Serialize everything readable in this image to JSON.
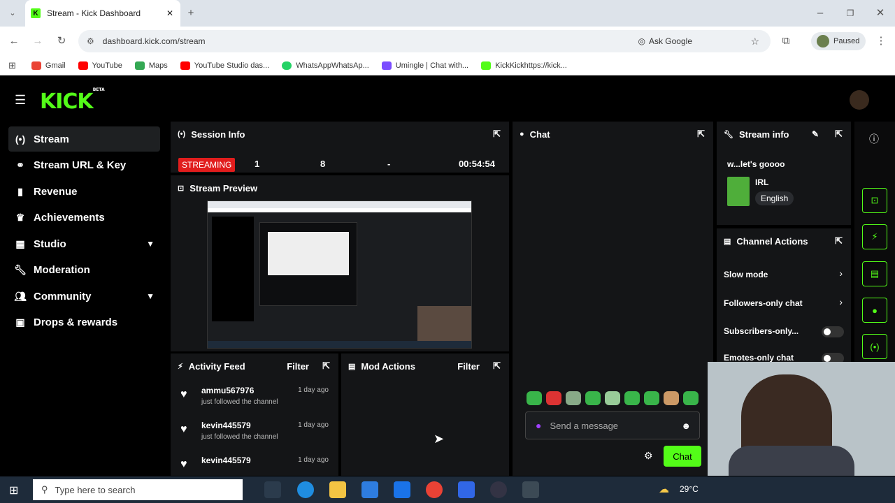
{
  "browser": {
    "tab_title": "Stream - Kick Dashboard",
    "url": "dashboard.kick.com/stream",
    "ask_google": "Ask Google",
    "profile_status": "Paused",
    "bookmarks": [
      "Gmail",
      "YouTube",
      "Maps",
      "YouTube Studio das...",
      "WhatsAppWhatsAp...",
      "Umingle | Chat with...",
      "KickKickhttps://kick..."
    ]
  },
  "app": {
    "logo": "KICK",
    "logo_badge": "BETA",
    "nav": [
      {
        "label": "Stream",
        "icon": "broadcast-icon",
        "active": true
      },
      {
        "label": "Stream URL & Key",
        "icon": "link-icon"
      },
      {
        "label": "Revenue",
        "icon": "chart-icon"
      },
      {
        "label": "Achievements",
        "icon": "trophy-icon"
      },
      {
        "label": "Studio",
        "icon": "studio-icon",
        "expandable": true
      },
      {
        "label": "Moderation",
        "icon": "wrench-icon"
      },
      {
        "label": "Community",
        "icon": "people-icon",
        "expandable": true
      },
      {
        "label": "Drops & rewards",
        "icon": "gift-icon"
      }
    ]
  },
  "session_info": {
    "title": "Session Info",
    "status": "STREAMING",
    "viewers": "1",
    "followers": "8",
    "subs": "-",
    "uptime": "00:54:54"
  },
  "stream_preview": {
    "title": "Stream Preview"
  },
  "activity_feed": {
    "title": "Activity Feed",
    "filter": "Filter",
    "items": [
      {
        "user": "ammu567976",
        "text": "just followed the channel",
        "time": "1 day ago"
      },
      {
        "user": "kevin445579",
        "text": "just followed the channel",
        "time": "1 day ago"
      },
      {
        "user": "kevin445579",
        "text": "",
        "time": "1 day ago"
      }
    ]
  },
  "mod_actions": {
    "title": "Mod Actions",
    "filter": "Filter"
  },
  "chat": {
    "title": "Chat",
    "placeholder": "Send a message",
    "send_label": "Chat"
  },
  "stream_info": {
    "title": "Stream info",
    "stream_title": "w...let's goooo",
    "category": "IRL",
    "language": "English"
  },
  "channel_actions": {
    "title": "Channel Actions",
    "items": [
      {
        "label": "Slow mode",
        "type": "arrow"
      },
      {
        "label": "Followers-only chat",
        "type": "arrow"
      },
      {
        "label": "Subscribers-only...",
        "type": "toggle"
      },
      {
        "label": "Emotes-only chat",
        "type": "toggle"
      }
    ]
  },
  "taskbar": {
    "search_placeholder": "Type here to search",
    "temperature": "29°C"
  },
  "colors": {
    "brand": "#53fc18",
    "panel": "#141517",
    "live": "#e11d1d"
  }
}
